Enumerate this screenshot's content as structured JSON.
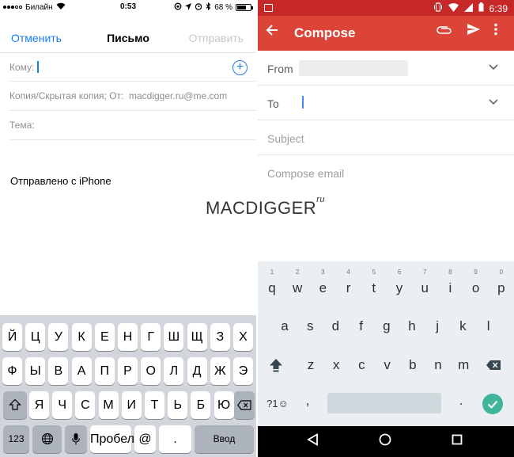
{
  "ios": {
    "status": {
      "carrier": "Билайн",
      "time": "0:53",
      "battery": "68 %",
      "battery_level": 0.68
    },
    "nav": {
      "cancel": "Отменить",
      "title": "Письмо",
      "send": "Отправить"
    },
    "fields": {
      "to_label": "Кому:",
      "cc_label": "Копия/Скрытая копия; От:",
      "from_value": "macdigger.ru@me.com",
      "subject_label": "Тема:"
    },
    "body": {
      "signature": "Отправлено с iPhone"
    },
    "keyboard": {
      "row1": [
        "Й",
        "Ц",
        "У",
        "К",
        "Е",
        "Н",
        "Г",
        "Ш",
        "Щ",
        "З",
        "Х"
      ],
      "row2": [
        "Ф",
        "Ы",
        "В",
        "А",
        "П",
        "Р",
        "О",
        "Л",
        "Д",
        "Ж",
        "Э"
      ],
      "row3": [
        "Я",
        "Ч",
        "С",
        "М",
        "И",
        "Т",
        "Ь",
        "Б",
        "Ю"
      ],
      "numbers": "123",
      "space": "Пробел",
      "at": "@",
      "dot": ".",
      "enter": "Ввод"
    }
  },
  "watermark": {
    "text": "MACDIGGER",
    "suffix": "ru"
  },
  "android": {
    "status": {
      "time": "6:39"
    },
    "app_bar": {
      "title": "Compose",
      "back_icon": "arrow-back-icon",
      "attach_icon": "paperclip-icon",
      "send_icon": "send-icon",
      "more_icon": "more-vert-icon"
    },
    "fields": {
      "from_label": "From",
      "to_label": "To",
      "subject_placeholder": "Subject",
      "body_placeholder": "Compose email"
    },
    "keyboard": {
      "row1": [
        "q",
        "w",
        "e",
        "r",
        "t",
        "y",
        "u",
        "i",
        "o",
        "p"
      ],
      "row1_hints": [
        "1",
        "2",
        "3",
        "4",
        "5",
        "6",
        "7",
        "8",
        "9",
        "0"
      ],
      "row2": [
        "a",
        "s",
        "d",
        "f",
        "g",
        "h",
        "j",
        "k",
        "l"
      ],
      "row3": [
        "z",
        "x",
        "c",
        "v",
        "b",
        "n",
        "m"
      ],
      "symbols": "?1☺",
      "comma": ",",
      "dot": "."
    },
    "colors": {
      "status_bar": "#c62828",
      "app_bar": "#db4437",
      "enter_key": "#3fb59b",
      "cursor": "#4285f4"
    }
  },
  "ios_colors": {
    "accent": "#1a7cf5",
    "keyboard_bg": "#d2d5db"
  }
}
